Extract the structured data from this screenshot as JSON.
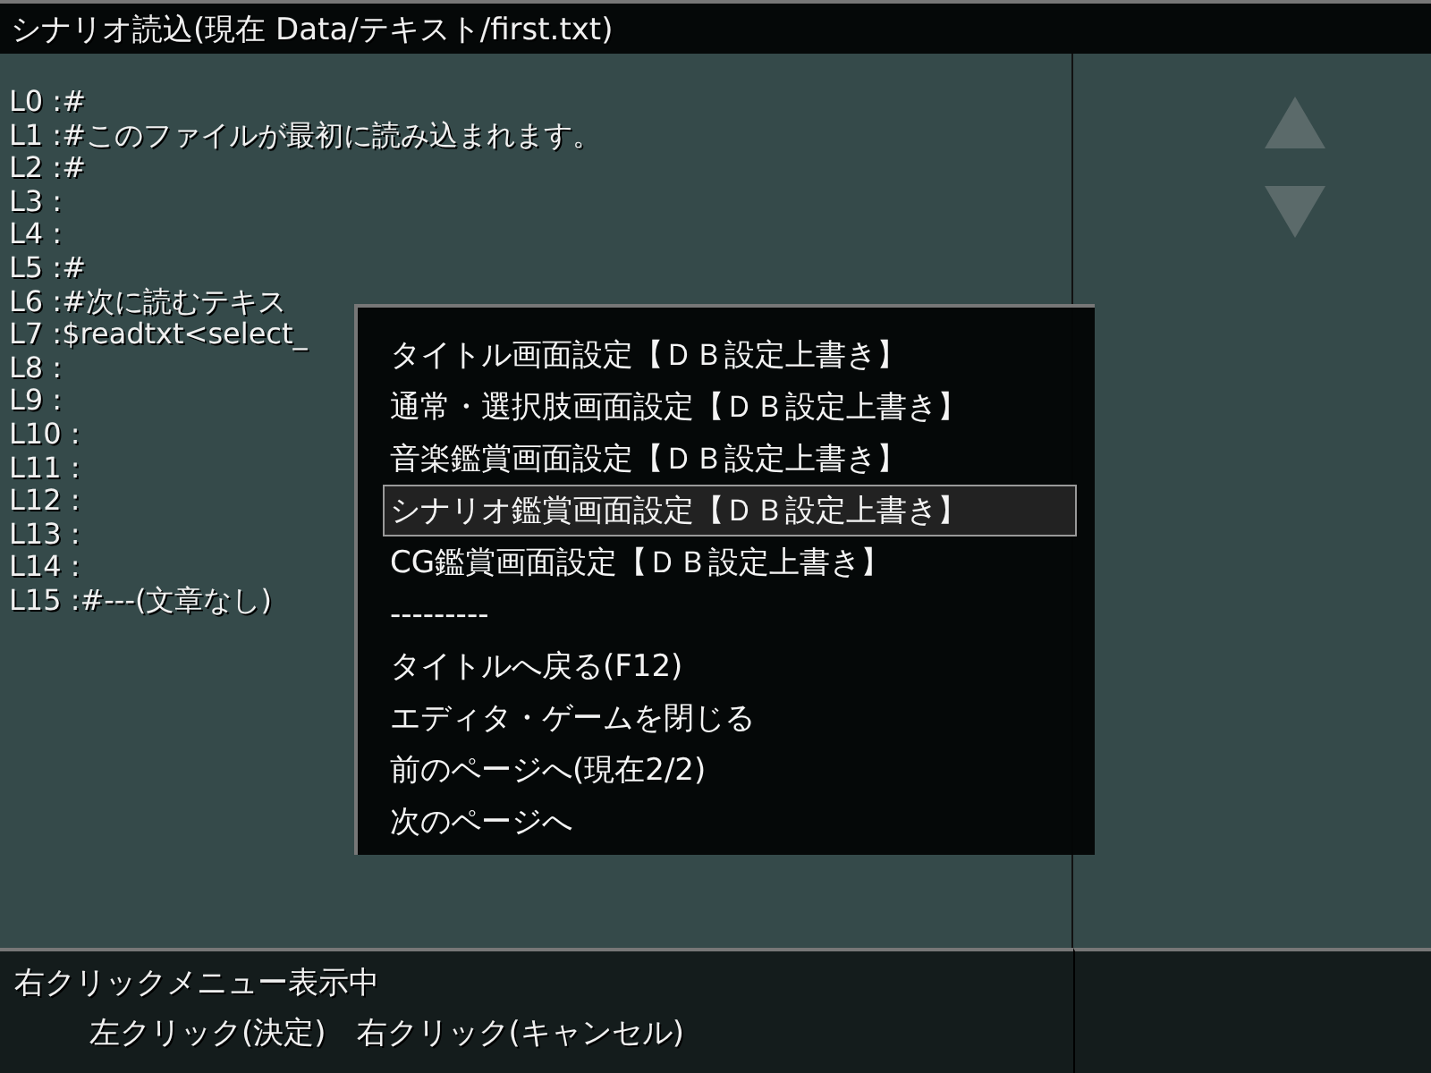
{
  "window": {
    "title": "シナリオ読込(現在 Data/テキスト/first.txt)"
  },
  "editor": {
    "lines": [
      "L0 :#",
      "L1 :#このファイルが最初に読み込まれます。",
      "L2 :#",
      "L3 :",
      "L4 :",
      "L5 :#",
      "L6 :#次に読むテキス",
      "L7 :$readtxt<select_",
      "L8 :",
      "L9 :",
      "L10 :",
      "L11 :",
      "L12 :",
      "L13 :",
      "L14 :",
      "L15 :#---(文章なし)"
    ]
  },
  "context_menu": {
    "items": [
      {
        "label": "タイトル画面設定【ＤＢ設定上書き】",
        "selected": false
      },
      {
        "label": "通常・選択肢画面設定【ＤＢ設定上書き】",
        "selected": false
      },
      {
        "label": "音楽鑑賞画面設定【ＤＢ設定上書き】",
        "selected": false
      },
      {
        "label": "シナリオ鑑賞画面設定【ＤＢ設定上書き】",
        "selected": true
      },
      {
        "label": "CG鑑賞画面設定【ＤＢ設定上書き】",
        "selected": false
      },
      {
        "label": "---------",
        "selected": false
      },
      {
        "label": "タイトルへ戻る(F12)",
        "selected": false
      },
      {
        "label": "エディタ・ゲームを閉じる",
        "selected": false
      },
      {
        "label": "前のページへ(現在2/2)",
        "selected": false
      },
      {
        "label": "次のページへ",
        "selected": false
      }
    ]
  },
  "status_bar": {
    "message": "右クリックメニュー表示中",
    "hint": "左クリック(決定)　右クリック(キャンセル)"
  }
}
